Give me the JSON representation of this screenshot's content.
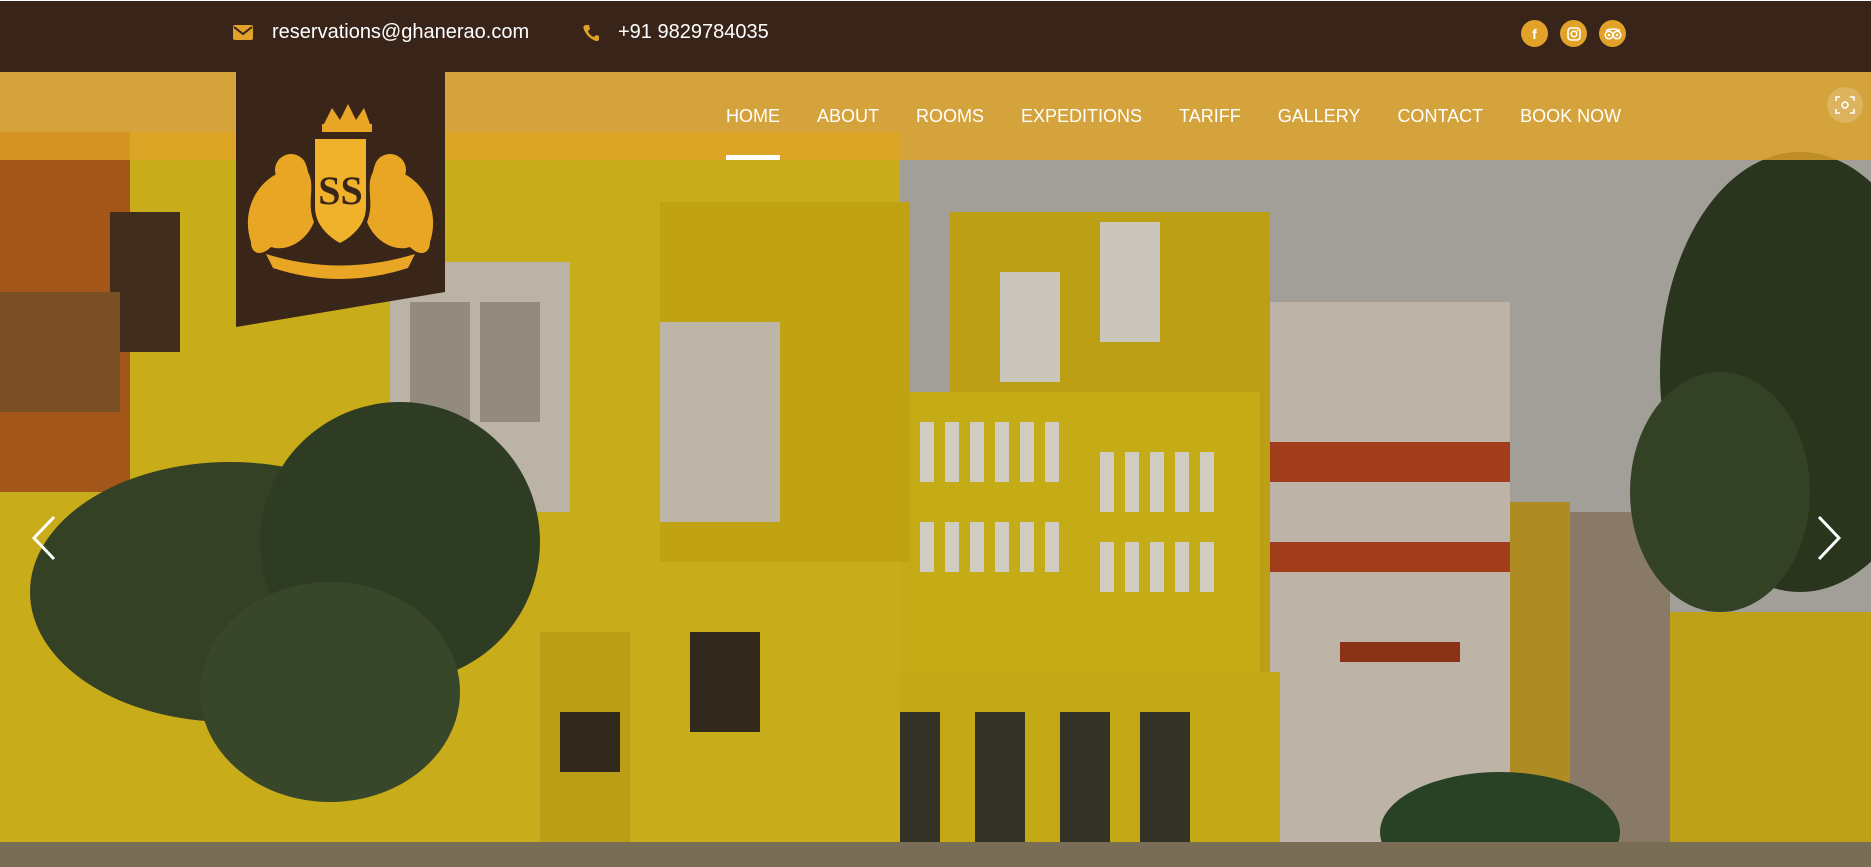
{
  "topbar": {
    "email": "reservations@ghanerao.com",
    "phone": "+91 9829784035",
    "email_icon": "envelope-icon",
    "phone_icon": "phone-icon",
    "socials": [
      {
        "name": "facebook-icon",
        "glyph": "f"
      },
      {
        "name": "instagram-icon",
        "glyph": ""
      },
      {
        "name": "tripadvisor-icon",
        "glyph": ""
      }
    ]
  },
  "nav": {
    "items": [
      "HOME",
      "ABOUT",
      "ROOMS",
      "EXPEDITIONS",
      "TARIFF",
      "GALLERY",
      "CONTACT",
      "BOOK NOW"
    ],
    "active": "HOME"
  },
  "logo": {
    "monogram": "SS"
  },
  "hero": {
    "prev_icon": "chevron-left-icon",
    "next_icon": "chevron-right-icon",
    "scan_icon": "screenshot-scan-icon"
  },
  "colors": {
    "topbar_bg": "#39241a",
    "accent": "#e2a22a",
    "navbar_bg": "#e0a328",
    "logo_bg": "#3a2519",
    "palace_yellow": "#e3c21a"
  }
}
